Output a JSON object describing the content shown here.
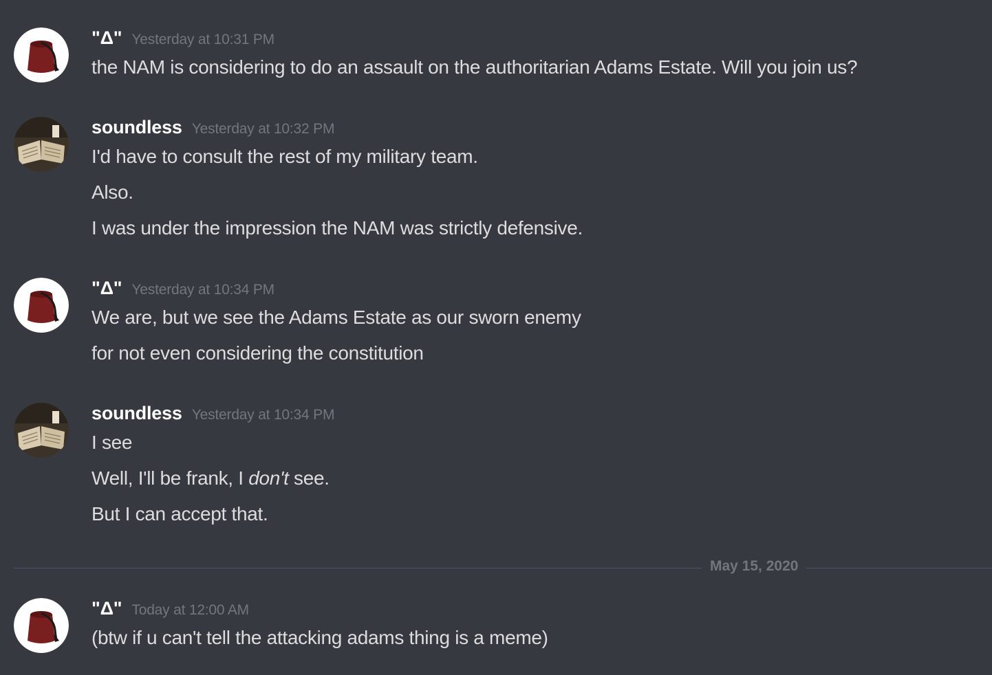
{
  "messages": [
    {
      "author": "\"Δ\"",
      "avatar_icon": "fez-hat-avatar",
      "timestamp": "Yesterday at 10:31 PM",
      "lines": [
        "the NAM is considering to do an assault on the authoritarian Adams Estate.  Will you join us?"
      ]
    },
    {
      "author": "soundless",
      "avatar_icon": "open-book-avatar",
      "timestamp": "Yesterday at 10:32 PM",
      "lines": [
        "I'd have to consult the rest of my military team.",
        "Also.",
        "I was under the impression the NAM was strictly defensive."
      ]
    },
    {
      "author": "\"Δ\"",
      "avatar_icon": "fez-hat-avatar",
      "timestamp": "Yesterday at 10:34 PM",
      "lines": [
        "We are, but we see the Adams Estate as our sworn enemy",
        "for not even considering the constitution"
      ]
    },
    {
      "author": "soundless",
      "avatar_icon": "open-book-avatar",
      "timestamp": "Yesterday at 10:34 PM",
      "lines": [
        "I see",
        {
          "before": "Well, I'll be frank, I ",
          "emphasis": "don't",
          "after": " see."
        },
        "But I can accept that."
      ]
    },
    {
      "author": "\"Δ\"",
      "avatar_icon": "fez-hat-avatar",
      "timestamp": "Today at 12:00 AM",
      "lines": [
        "(btw if u can't tell the attacking adams thing is a meme)"
      ]
    }
  ],
  "date_divider": "May 15, 2020",
  "colors": {
    "background": "#36393f",
    "username": "#ffffff",
    "message_text": "#dcddde",
    "timestamp": "#72767d",
    "divider": "#4f545c",
    "fez_red": "#7a1f1f"
  }
}
